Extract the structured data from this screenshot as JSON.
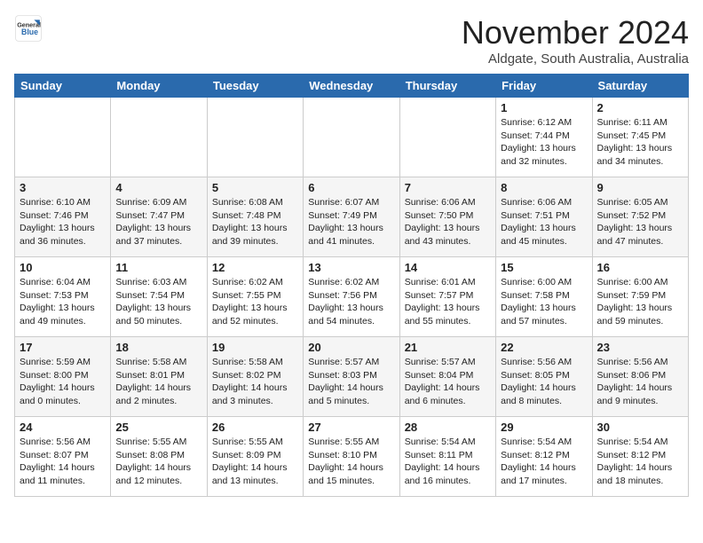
{
  "header": {
    "logo": {
      "general": "General",
      "blue": "Blue"
    },
    "title": "November 2024",
    "location": "Aldgate, South Australia, Australia"
  },
  "calendar": {
    "days_of_week": [
      "Sunday",
      "Monday",
      "Tuesday",
      "Wednesday",
      "Thursday",
      "Friday",
      "Saturday"
    ],
    "weeks": [
      [
        {
          "day": "",
          "info": ""
        },
        {
          "day": "",
          "info": ""
        },
        {
          "day": "",
          "info": ""
        },
        {
          "day": "",
          "info": ""
        },
        {
          "day": "",
          "info": ""
        },
        {
          "day": "1",
          "info": "Sunrise: 6:12 AM\nSunset: 7:44 PM\nDaylight: 13 hours\nand 32 minutes."
        },
        {
          "day": "2",
          "info": "Sunrise: 6:11 AM\nSunset: 7:45 PM\nDaylight: 13 hours\nand 34 minutes."
        }
      ],
      [
        {
          "day": "3",
          "info": "Sunrise: 6:10 AM\nSunset: 7:46 PM\nDaylight: 13 hours\nand 36 minutes."
        },
        {
          "day": "4",
          "info": "Sunrise: 6:09 AM\nSunset: 7:47 PM\nDaylight: 13 hours\nand 37 minutes."
        },
        {
          "day": "5",
          "info": "Sunrise: 6:08 AM\nSunset: 7:48 PM\nDaylight: 13 hours\nand 39 minutes."
        },
        {
          "day": "6",
          "info": "Sunrise: 6:07 AM\nSunset: 7:49 PM\nDaylight: 13 hours\nand 41 minutes."
        },
        {
          "day": "7",
          "info": "Sunrise: 6:06 AM\nSunset: 7:50 PM\nDaylight: 13 hours\nand 43 minutes."
        },
        {
          "day": "8",
          "info": "Sunrise: 6:06 AM\nSunset: 7:51 PM\nDaylight: 13 hours\nand 45 minutes."
        },
        {
          "day": "9",
          "info": "Sunrise: 6:05 AM\nSunset: 7:52 PM\nDaylight: 13 hours\nand 47 minutes."
        }
      ],
      [
        {
          "day": "10",
          "info": "Sunrise: 6:04 AM\nSunset: 7:53 PM\nDaylight: 13 hours\nand 49 minutes."
        },
        {
          "day": "11",
          "info": "Sunrise: 6:03 AM\nSunset: 7:54 PM\nDaylight: 13 hours\nand 50 minutes."
        },
        {
          "day": "12",
          "info": "Sunrise: 6:02 AM\nSunset: 7:55 PM\nDaylight: 13 hours\nand 52 minutes."
        },
        {
          "day": "13",
          "info": "Sunrise: 6:02 AM\nSunset: 7:56 PM\nDaylight: 13 hours\nand 54 minutes."
        },
        {
          "day": "14",
          "info": "Sunrise: 6:01 AM\nSunset: 7:57 PM\nDaylight: 13 hours\nand 55 minutes."
        },
        {
          "day": "15",
          "info": "Sunrise: 6:00 AM\nSunset: 7:58 PM\nDaylight: 13 hours\nand 57 minutes."
        },
        {
          "day": "16",
          "info": "Sunrise: 6:00 AM\nSunset: 7:59 PM\nDaylight: 13 hours\nand 59 minutes."
        }
      ],
      [
        {
          "day": "17",
          "info": "Sunrise: 5:59 AM\nSunset: 8:00 PM\nDaylight: 14 hours\nand 0 minutes."
        },
        {
          "day": "18",
          "info": "Sunrise: 5:58 AM\nSunset: 8:01 PM\nDaylight: 14 hours\nand 2 minutes."
        },
        {
          "day": "19",
          "info": "Sunrise: 5:58 AM\nSunset: 8:02 PM\nDaylight: 14 hours\nand 3 minutes."
        },
        {
          "day": "20",
          "info": "Sunrise: 5:57 AM\nSunset: 8:03 PM\nDaylight: 14 hours\nand 5 minutes."
        },
        {
          "day": "21",
          "info": "Sunrise: 5:57 AM\nSunset: 8:04 PM\nDaylight: 14 hours\nand 6 minutes."
        },
        {
          "day": "22",
          "info": "Sunrise: 5:56 AM\nSunset: 8:05 PM\nDaylight: 14 hours\nand 8 minutes."
        },
        {
          "day": "23",
          "info": "Sunrise: 5:56 AM\nSunset: 8:06 PM\nDaylight: 14 hours\nand 9 minutes."
        }
      ],
      [
        {
          "day": "24",
          "info": "Sunrise: 5:56 AM\nSunset: 8:07 PM\nDaylight: 14 hours\nand 11 minutes."
        },
        {
          "day": "25",
          "info": "Sunrise: 5:55 AM\nSunset: 8:08 PM\nDaylight: 14 hours\nand 12 minutes."
        },
        {
          "day": "26",
          "info": "Sunrise: 5:55 AM\nSunset: 8:09 PM\nDaylight: 14 hours\nand 13 minutes."
        },
        {
          "day": "27",
          "info": "Sunrise: 5:55 AM\nSunset: 8:10 PM\nDaylight: 14 hours\nand 15 minutes."
        },
        {
          "day": "28",
          "info": "Sunrise: 5:54 AM\nSunset: 8:11 PM\nDaylight: 14 hours\nand 16 minutes."
        },
        {
          "day": "29",
          "info": "Sunrise: 5:54 AM\nSunset: 8:12 PM\nDaylight: 14 hours\nand 17 minutes."
        },
        {
          "day": "30",
          "info": "Sunrise: 5:54 AM\nSunset: 8:12 PM\nDaylight: 14 hours\nand 18 minutes."
        }
      ]
    ]
  }
}
